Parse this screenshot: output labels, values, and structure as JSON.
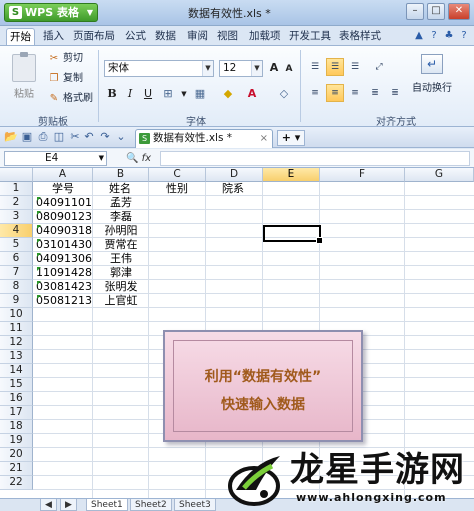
{
  "app": {
    "name": "WPS 表格",
    "logo_letter": "S",
    "dropdown": "▼"
  },
  "window": {
    "title": "数据有效性.xls *",
    "controls": [
      "–",
      "□",
      "✕"
    ]
  },
  "ribbon_tabs": [
    "开始",
    "插入",
    "页面布局",
    "公式",
    "数据",
    "审阅",
    "视图",
    "加载项",
    "开发工具",
    "表格样式"
  ],
  "tab_icons": [
    "▲",
    "?",
    "♣",
    "?"
  ],
  "clipboard": {
    "paste": "粘贴",
    "cut": "剪切",
    "copy": "复制",
    "format_painter": "格式刷",
    "label": "剪贴板"
  },
  "font": {
    "name": "宋体",
    "size": "12",
    "grow": "A",
    "shrink": "A",
    "clear": "◇",
    "bold": "B",
    "italic": "I",
    "underline": "U",
    "label": "字体"
  },
  "alignment": {
    "wrap": "自动换行",
    "label": "对齐方式"
  },
  "quick_access": {
    "doc_tab": "数据有效性.xls *",
    "doc_close": "×",
    "new_tab": "+ ▾"
  },
  "formula_bar": {
    "name_box": "E4",
    "fx": "fx",
    "value": ""
  },
  "columns": [
    "A",
    "B",
    "C",
    "D",
    "E",
    "F",
    "G"
  ],
  "rows": [
    "1",
    "2",
    "3",
    "4",
    "5",
    "6",
    "7",
    "8",
    "9",
    "10",
    "11",
    "12",
    "13",
    "14",
    "15",
    "16",
    "17",
    "18",
    "19",
    "20",
    "21",
    "22"
  ],
  "cells": {
    "headers": [
      "学号",
      "姓名",
      "性别",
      "院系"
    ],
    "data": [
      [
        "04091101",
        "孟芳"
      ],
      [
        "08090123",
        "李磊"
      ],
      [
        "04090318",
        "孙明阳"
      ],
      [
        "03101430",
        "贾常在"
      ],
      [
        "04091306",
        "王伟"
      ],
      [
        "11091428",
        "郭津"
      ],
      [
        "03081423",
        "张明发"
      ],
      [
        "05081213",
        "上官虹"
      ]
    ]
  },
  "active_cell": "E4",
  "overlay": {
    "line1": "利用“数据有效性”",
    "line2": "快速输入数据"
  },
  "sheet_tabs": [
    "◀",
    "▶",
    "Sheet1",
    "Sheet2",
    "Sheet3"
  ],
  "watermark": {
    "name": "龙星手游网",
    "url": "www.ahlongxing.com"
  },
  "colors": {
    "accent": "#3e9a2a",
    "active_header": "#f8cf6d",
    "overlay_text": "#a05a1c"
  }
}
